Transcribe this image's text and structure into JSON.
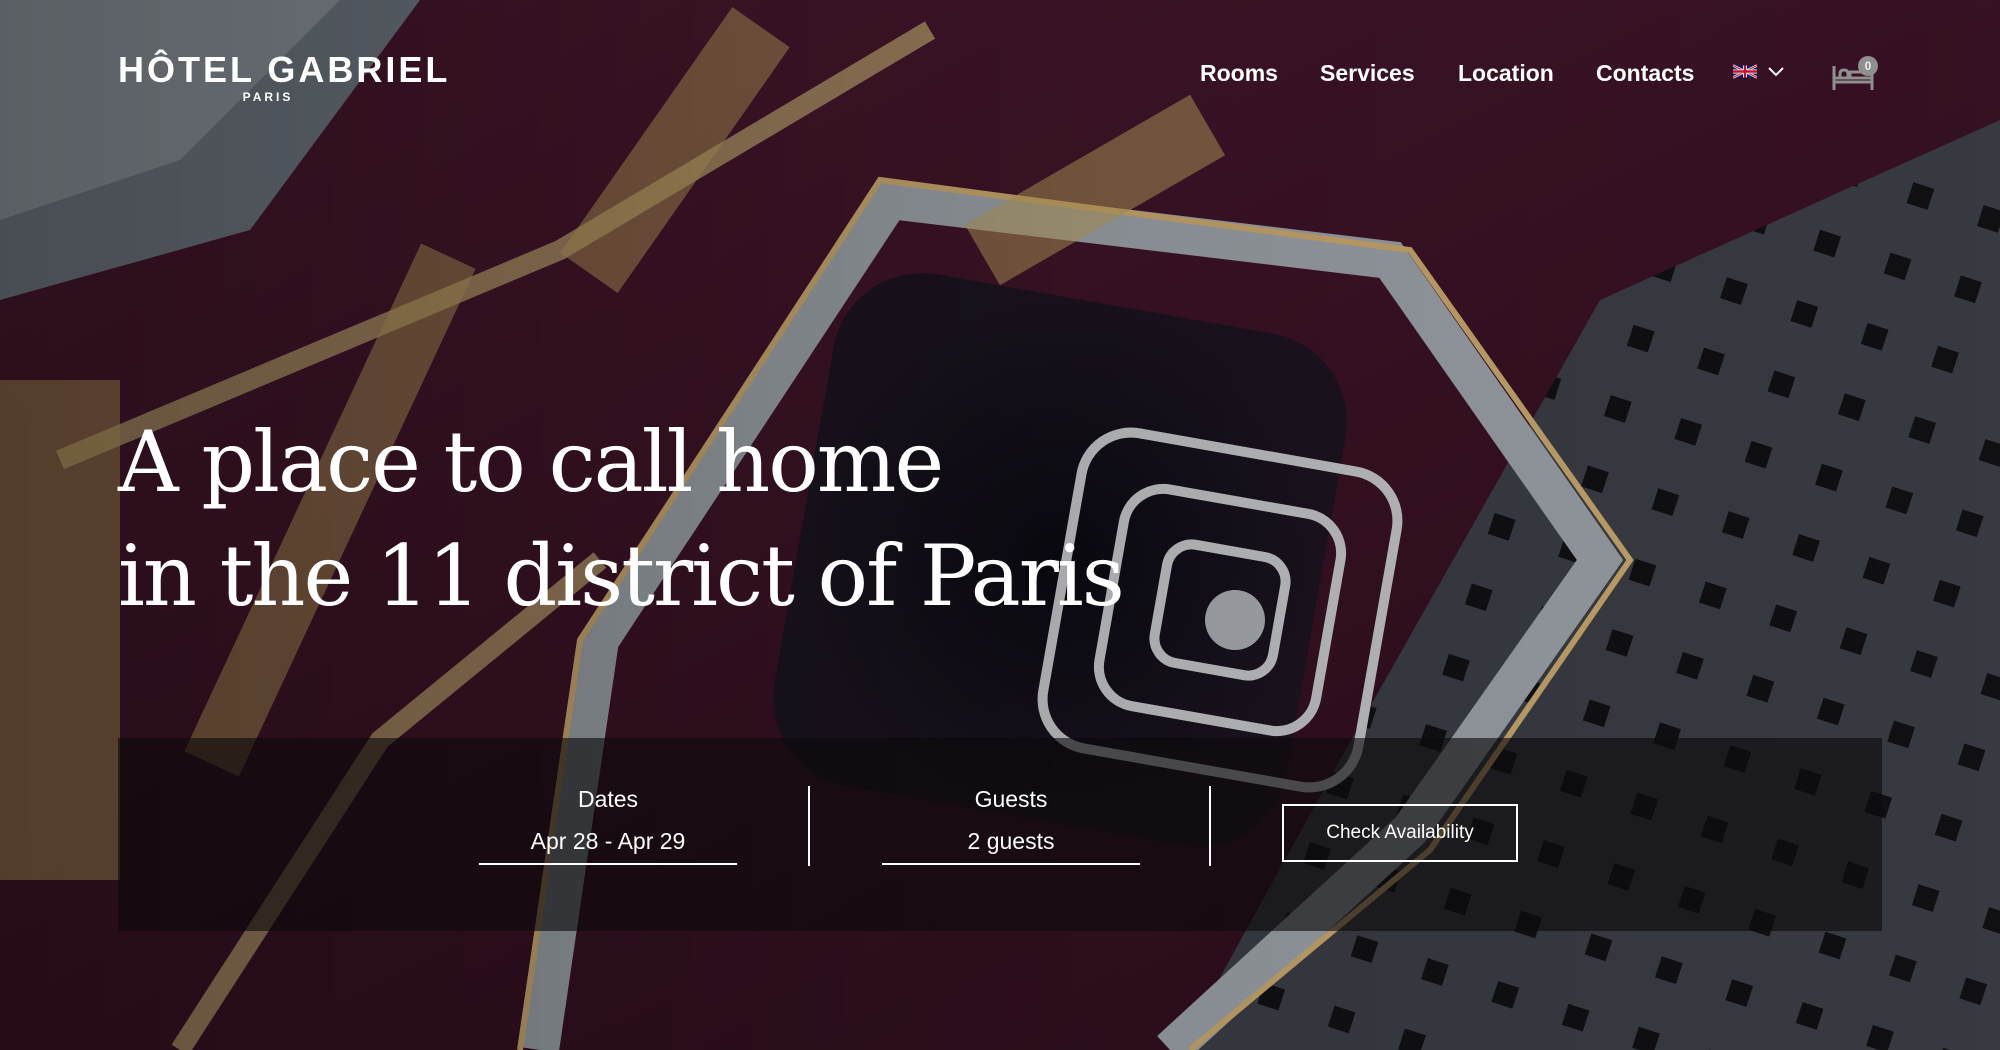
{
  "logo": {
    "name": "HÔTEL GABRIEL",
    "city": "PARIS"
  },
  "nav": {
    "items": [
      {
        "label": "Rooms"
      },
      {
        "label": "Services"
      },
      {
        "label": "Location"
      },
      {
        "label": "Contacts"
      }
    ],
    "language_icon": "uk-flag-icon",
    "cart_icon": "bed-icon",
    "cart_count": "0"
  },
  "hero": {
    "line1": "A place to call home",
    "line2": "in the 11 district of Paris"
  },
  "booking": {
    "dates_label": "Dates",
    "dates_value": "Apr 28 - Apr 29",
    "guests_label": "Guests",
    "guests_value": "2 guests",
    "cta_label": "Check Availability"
  }
}
